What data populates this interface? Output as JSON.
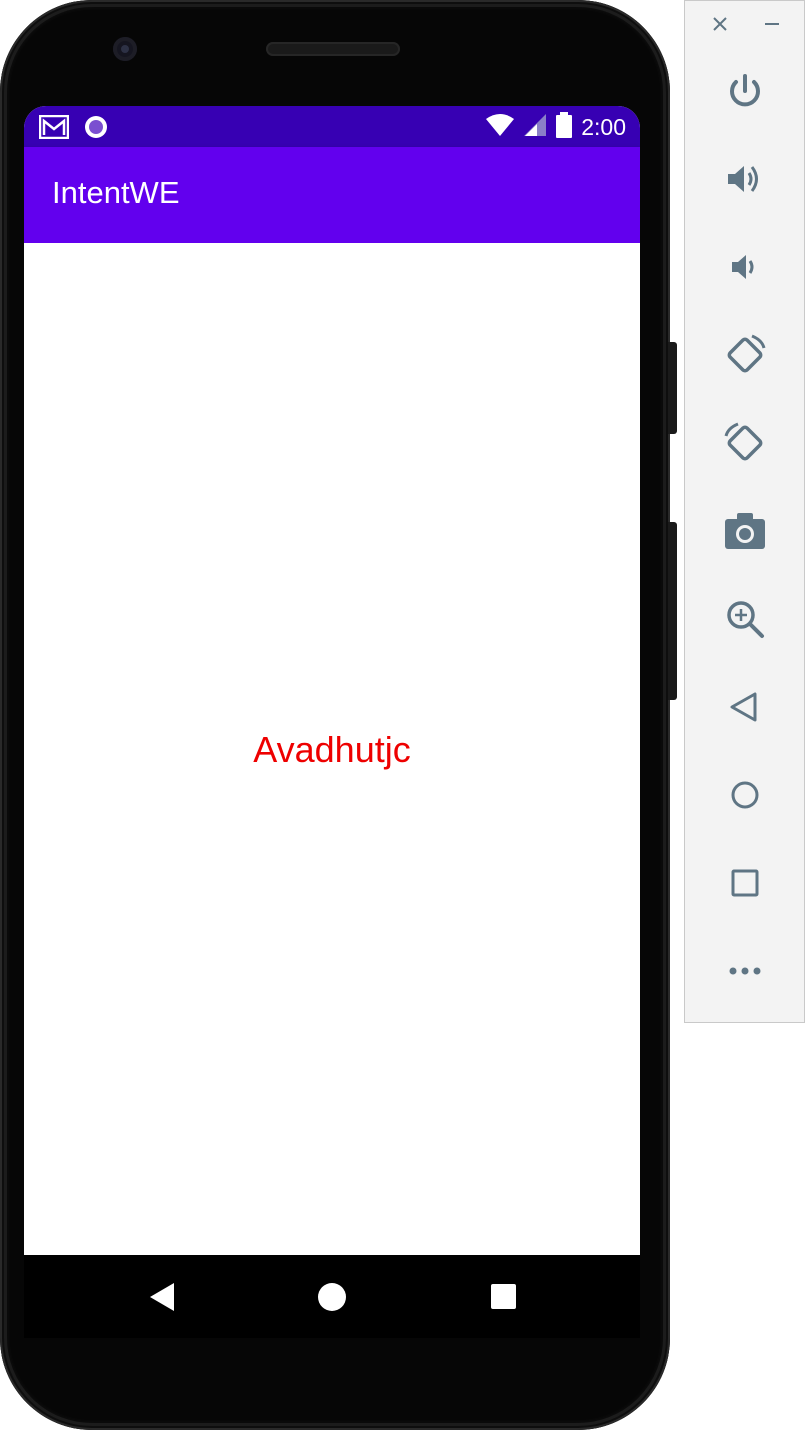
{
  "status_bar": {
    "time": "2:00",
    "icons": [
      "gmail-icon",
      "sync-circle-icon",
      "wifi-icon",
      "cell-signal-icon",
      "battery-icon"
    ],
    "color": "#3700b3"
  },
  "app_bar": {
    "title": "IntentWE",
    "color": "#6200ee"
  },
  "content": {
    "text": "Avadhutjc",
    "text_color": "#ee0000"
  },
  "nav_bar": {
    "buttons": [
      "back-icon",
      "home-icon",
      "recents-icon"
    ]
  },
  "emulator_toolbar": {
    "window_controls": [
      "close-icon",
      "minimize-icon"
    ],
    "buttons": [
      "power-icon",
      "volume-up-icon",
      "volume-down-icon",
      "rotate-left-icon",
      "rotate-right-icon",
      "camera-icon",
      "zoom-icon",
      "back-icon",
      "home-icon",
      "overview-icon",
      "more-icon"
    ],
    "icon_color": "#5f7584"
  }
}
